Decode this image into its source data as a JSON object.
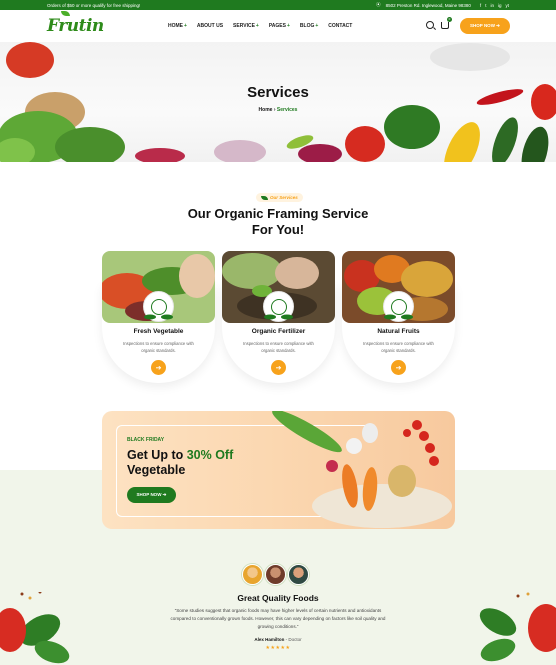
{
  "topbar": {
    "promo": "Orders of $50 or more qualify for free shipping!",
    "address": "8502 Preston Rd. Inglewood, Maine 98380",
    "socials": [
      "f",
      "t",
      "in",
      "ig",
      "yt"
    ]
  },
  "header": {
    "logo": "Frutin",
    "nav": [
      {
        "label": "HOME",
        "has_submenu": true
      },
      {
        "label": "ABOUT US",
        "has_submenu": false
      },
      {
        "label": "SERVICE",
        "has_submenu": true
      },
      {
        "label": "PAGES",
        "has_submenu": true
      },
      {
        "label": "BLOG",
        "has_submenu": true
      },
      {
        "label": "CONTACT",
        "has_submenu": false
      }
    ],
    "plus": "+",
    "cart_count": "0",
    "shop_button": "SHOP NOW ➔"
  },
  "hero": {
    "title": "Services",
    "breadcrumb_home": "Home",
    "breadcrumb_sep": " › ",
    "breadcrumb_current": "Services"
  },
  "services": {
    "tag": "Our Services",
    "title_line1": "Our Organic Framing Service",
    "title_line2": "For You!",
    "cards": [
      {
        "title": "Fresh Vegetable",
        "text": "Inspections to ensure compliance with organic standards.",
        "arrow": "➔"
      },
      {
        "title": "Organic Fertilizer",
        "text": "Inspections to ensure compliance with organic standards.",
        "arrow": "➔"
      },
      {
        "title": "Natural Fruits",
        "text": "Inspections to ensure compliance with organic standards.",
        "arrow": "➔"
      }
    ]
  },
  "promo": {
    "tag": "BLACK FRIDAY",
    "line1_prefix": "Get Up to ",
    "line1_highlight": "30% Off",
    "line2": "Vegetable",
    "button": "SHOP NOW ➔"
  },
  "testimonial": {
    "title": "Great Quality Foods",
    "quote": "“Some studies suggest that organic foods may have higher levels of certain nutrients and antioxidants compared to conventionally grown foods. However, this can vary depending on factors like soil quality and growing conditions.”",
    "author": "Alex Hamilton",
    "role": " - Doctor",
    "stars": "★★★★★"
  },
  "colors": {
    "brand_green": "#1f7a1f",
    "accent_orange": "#f7a21b",
    "band": "#f1f5ea"
  }
}
